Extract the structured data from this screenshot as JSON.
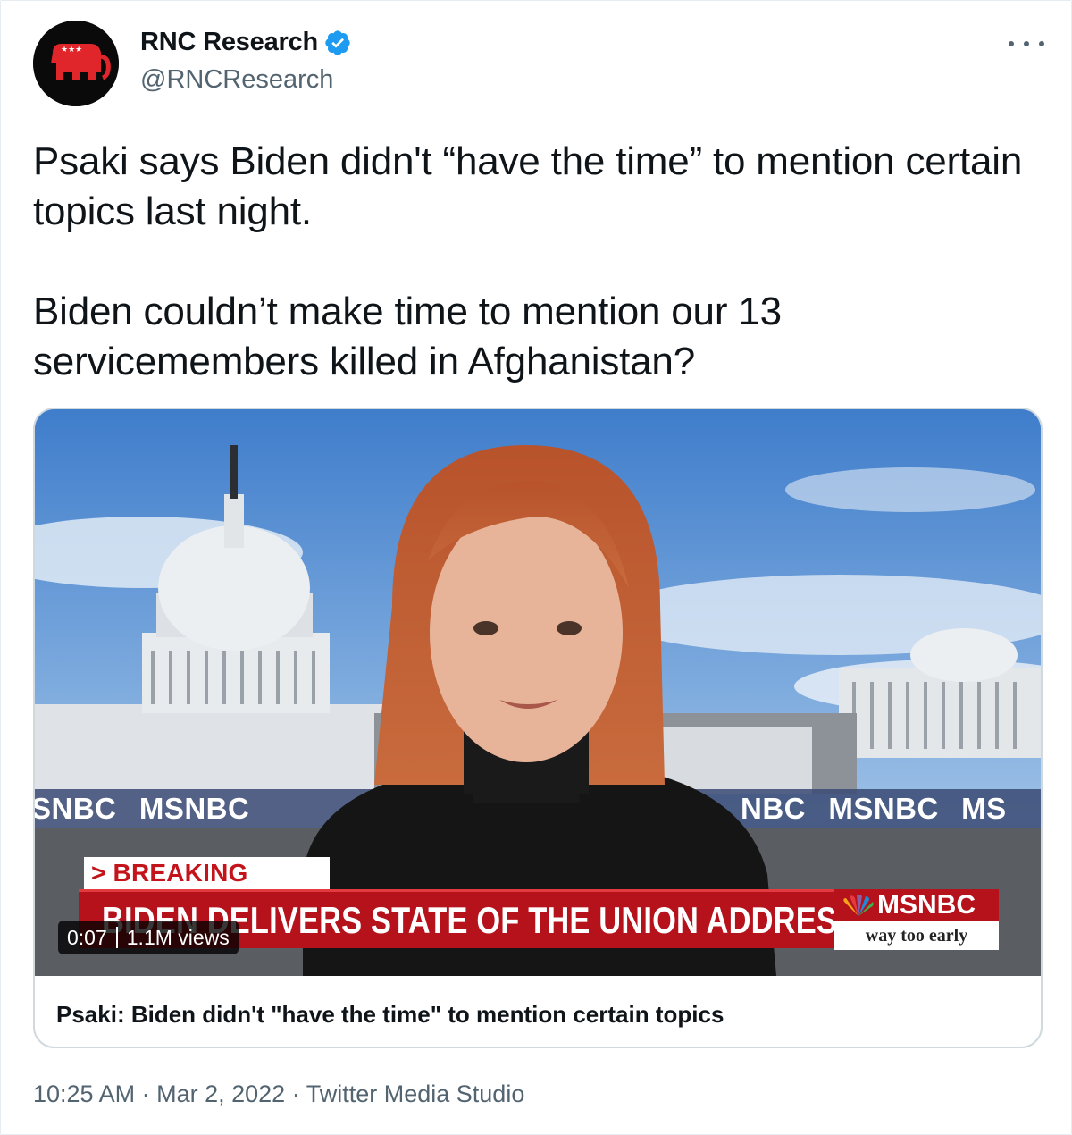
{
  "tweet": {
    "author": {
      "display_name": "RNC Research",
      "handle": "@RNCResearch",
      "verified": true,
      "avatar_icon": "gop-elephant-icon"
    },
    "text": "Psaki says Biden didn't “have the time” to mention certain topics last night.\n\nBiden couldn’t make time to mention our 13 servicemembers killed in Afghanistan?",
    "media": {
      "type": "video",
      "duration": "0:07",
      "views": "1.1M views",
      "title": "Psaki: Biden didn't \"have the time\" to mention certain topics",
      "overlay": {
        "ticker_left": "SNBC   MSNBC",
        "ticker_right": "NBC   MSNBC   MS",
        "breaking_label": "> BREAKING NEWS",
        "headline": "BIDEN DELIVERS STATE OF THE UNION ADDRESS",
        "network": "MSNBC",
        "show": "way too early"
      }
    },
    "time": "10:25 AM",
    "date": "Mar 2, 2022",
    "source": "Twitter Media Studio",
    "separator": "·"
  },
  "colors": {
    "verified_blue": "#1d9bf0",
    "secondary_text": "#536471",
    "msnbc_red": "#b5121b"
  }
}
